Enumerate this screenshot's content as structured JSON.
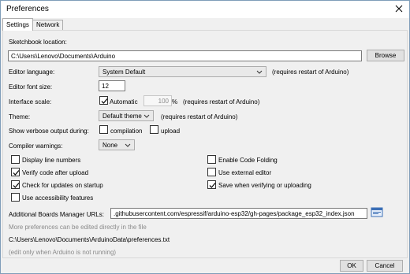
{
  "window": {
    "title": "Preferences"
  },
  "tabs": [
    "Settings",
    "Network"
  ],
  "sketchbook": {
    "label": "Sketchbook location:",
    "value": "C:\\Users\\Lenovo\\Documents\\Arduino",
    "browse_label": "Browse"
  },
  "language": {
    "label": "Editor language:",
    "value": "System Default",
    "note": "(requires restart of Arduino)"
  },
  "font_size": {
    "label": "Editor font size:",
    "value": "12"
  },
  "scale": {
    "label": "Interface scale:",
    "auto_label": "Automatic",
    "value": "100",
    "unit": "%",
    "note": "(requires restart of Arduino)",
    "automatic_checked": true
  },
  "theme": {
    "label": "Theme:",
    "value": "Default theme",
    "note": "(requires restart of Arduino)"
  },
  "verbose": {
    "label": "Show verbose output during:",
    "compilation_label": "compilation",
    "upload_label": "upload",
    "compilation_checked": false,
    "upload_checked": false
  },
  "warnings": {
    "label": "Compiler warnings:",
    "value": "None"
  },
  "options_left": [
    {
      "label": "Display line numbers",
      "checked": false
    },
    {
      "label": "Verify code after upload",
      "checked": true
    },
    {
      "label": "Check for updates on startup",
      "checked": true
    },
    {
      "label": "Use accessibility features",
      "checked": false
    }
  ],
  "options_right": [
    {
      "label": "Enable Code Folding",
      "checked": false
    },
    {
      "label": "Use external editor",
      "checked": false
    },
    {
      "label": "Save when verifying or uploading",
      "checked": true
    }
  ],
  "boards": {
    "label": "Additional Boards Manager URLs:",
    "value": ".githubusercontent.com/espressif/arduino-esp32/gh-pages/package_esp32_index.json"
  },
  "prefs_file": {
    "note": "More preferences can be edited directly in the file",
    "path": "C:\\Users\\Lenovo\\Documents\\ArduinoData\\preferences.txt",
    "edit_note": "(edit only when Arduino is not running)"
  },
  "buttons": {
    "ok_label": "OK",
    "cancel_label": "Cancel"
  }
}
